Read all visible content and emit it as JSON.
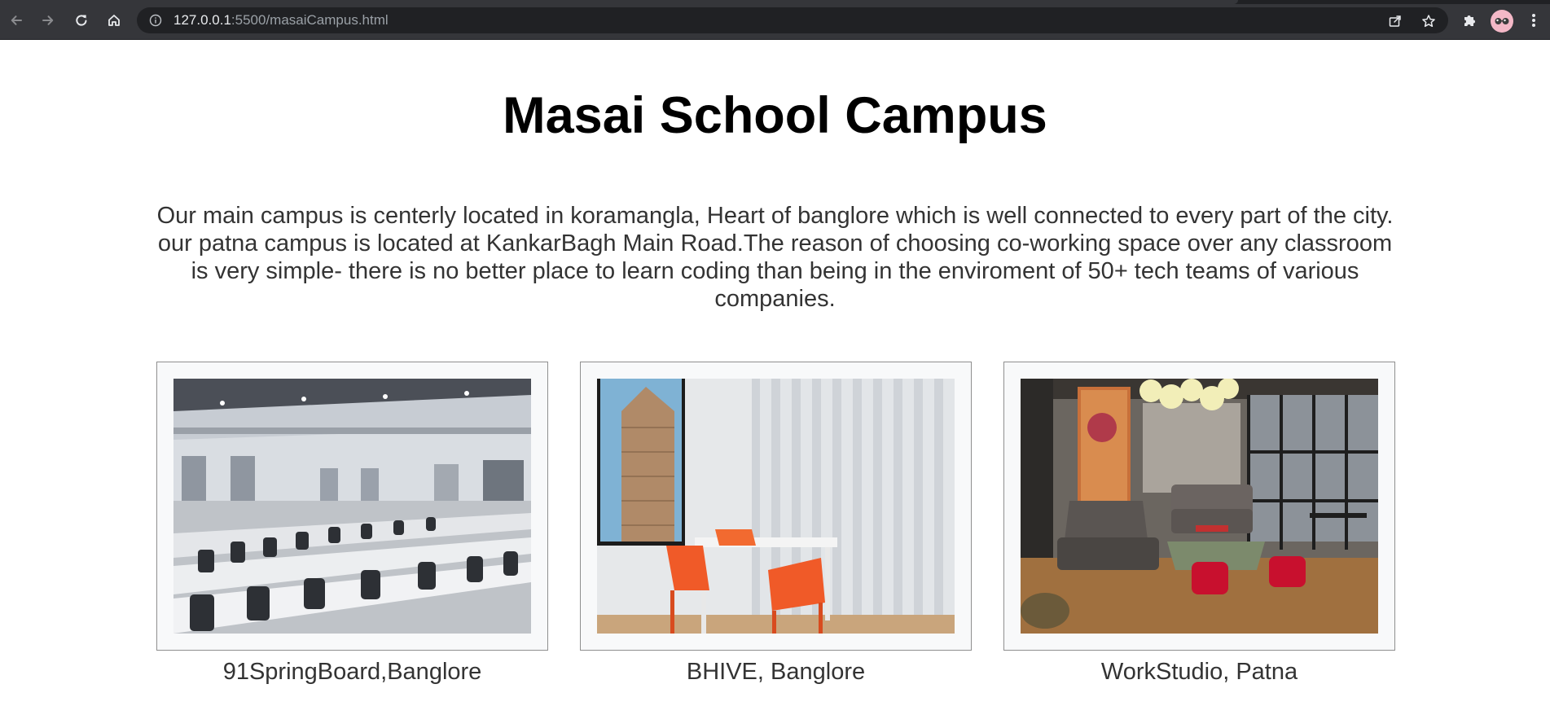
{
  "browser": {
    "url_host": "127.0.0.1",
    "url_path": ":5500/masaiCampus.html",
    "icons": [
      "back-icon",
      "forward-icon",
      "reload-icon",
      "home-icon",
      "info-icon",
      "share-icon",
      "star-icon",
      "extensions-icon",
      "profile-avatar",
      "menu-icon"
    ]
  },
  "page": {
    "title": "Masai School Campus",
    "intro": "Our main campus is centerly located in koramangla, Heart of banglore which is well connected to every part of the city. our patna campus is located at KankarBagh Main Road.The reason of choosing co-working space over any classroom is very simple- there is no better place to learn coding than being in the enviroment of 50+ tech teams of various companies."
  },
  "campuses": [
    {
      "caption": "91SpringBoard,Banglore"
    },
    {
      "caption": "BHIVE, Banglore"
    },
    {
      "caption": "WorkStudio, Patna"
    }
  ],
  "colors": {
    "chrome_bg": "#35363a",
    "omnibox_bg": "#202124",
    "card_bg": "#f8f9fa",
    "text": "#333333"
  }
}
